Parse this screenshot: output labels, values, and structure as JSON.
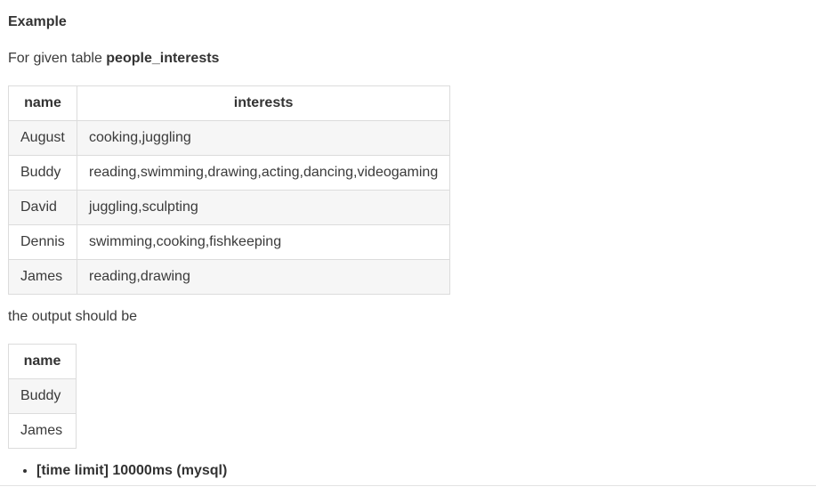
{
  "heading": "Example",
  "intro": {
    "prefix": "For given table ",
    "table_name": "people_interests"
  },
  "input_table": {
    "columns": [
      "name",
      "interests"
    ],
    "rows": [
      [
        "August",
        "cooking,juggling"
      ],
      [
        "Buddy",
        "reading,swimming,drawing,acting,dancing,videogaming"
      ],
      [
        "David",
        "juggling,sculpting"
      ],
      [
        "Dennis",
        "swimming,cooking,fishkeeping"
      ],
      [
        "James",
        "reading,drawing"
      ]
    ]
  },
  "output_label": "the output should be",
  "output_table": {
    "columns": [
      "name"
    ],
    "rows": [
      [
        "Buddy"
      ],
      [
        "James"
      ]
    ]
  },
  "notes": [
    "[time limit] 10000ms (mysql)"
  ]
}
